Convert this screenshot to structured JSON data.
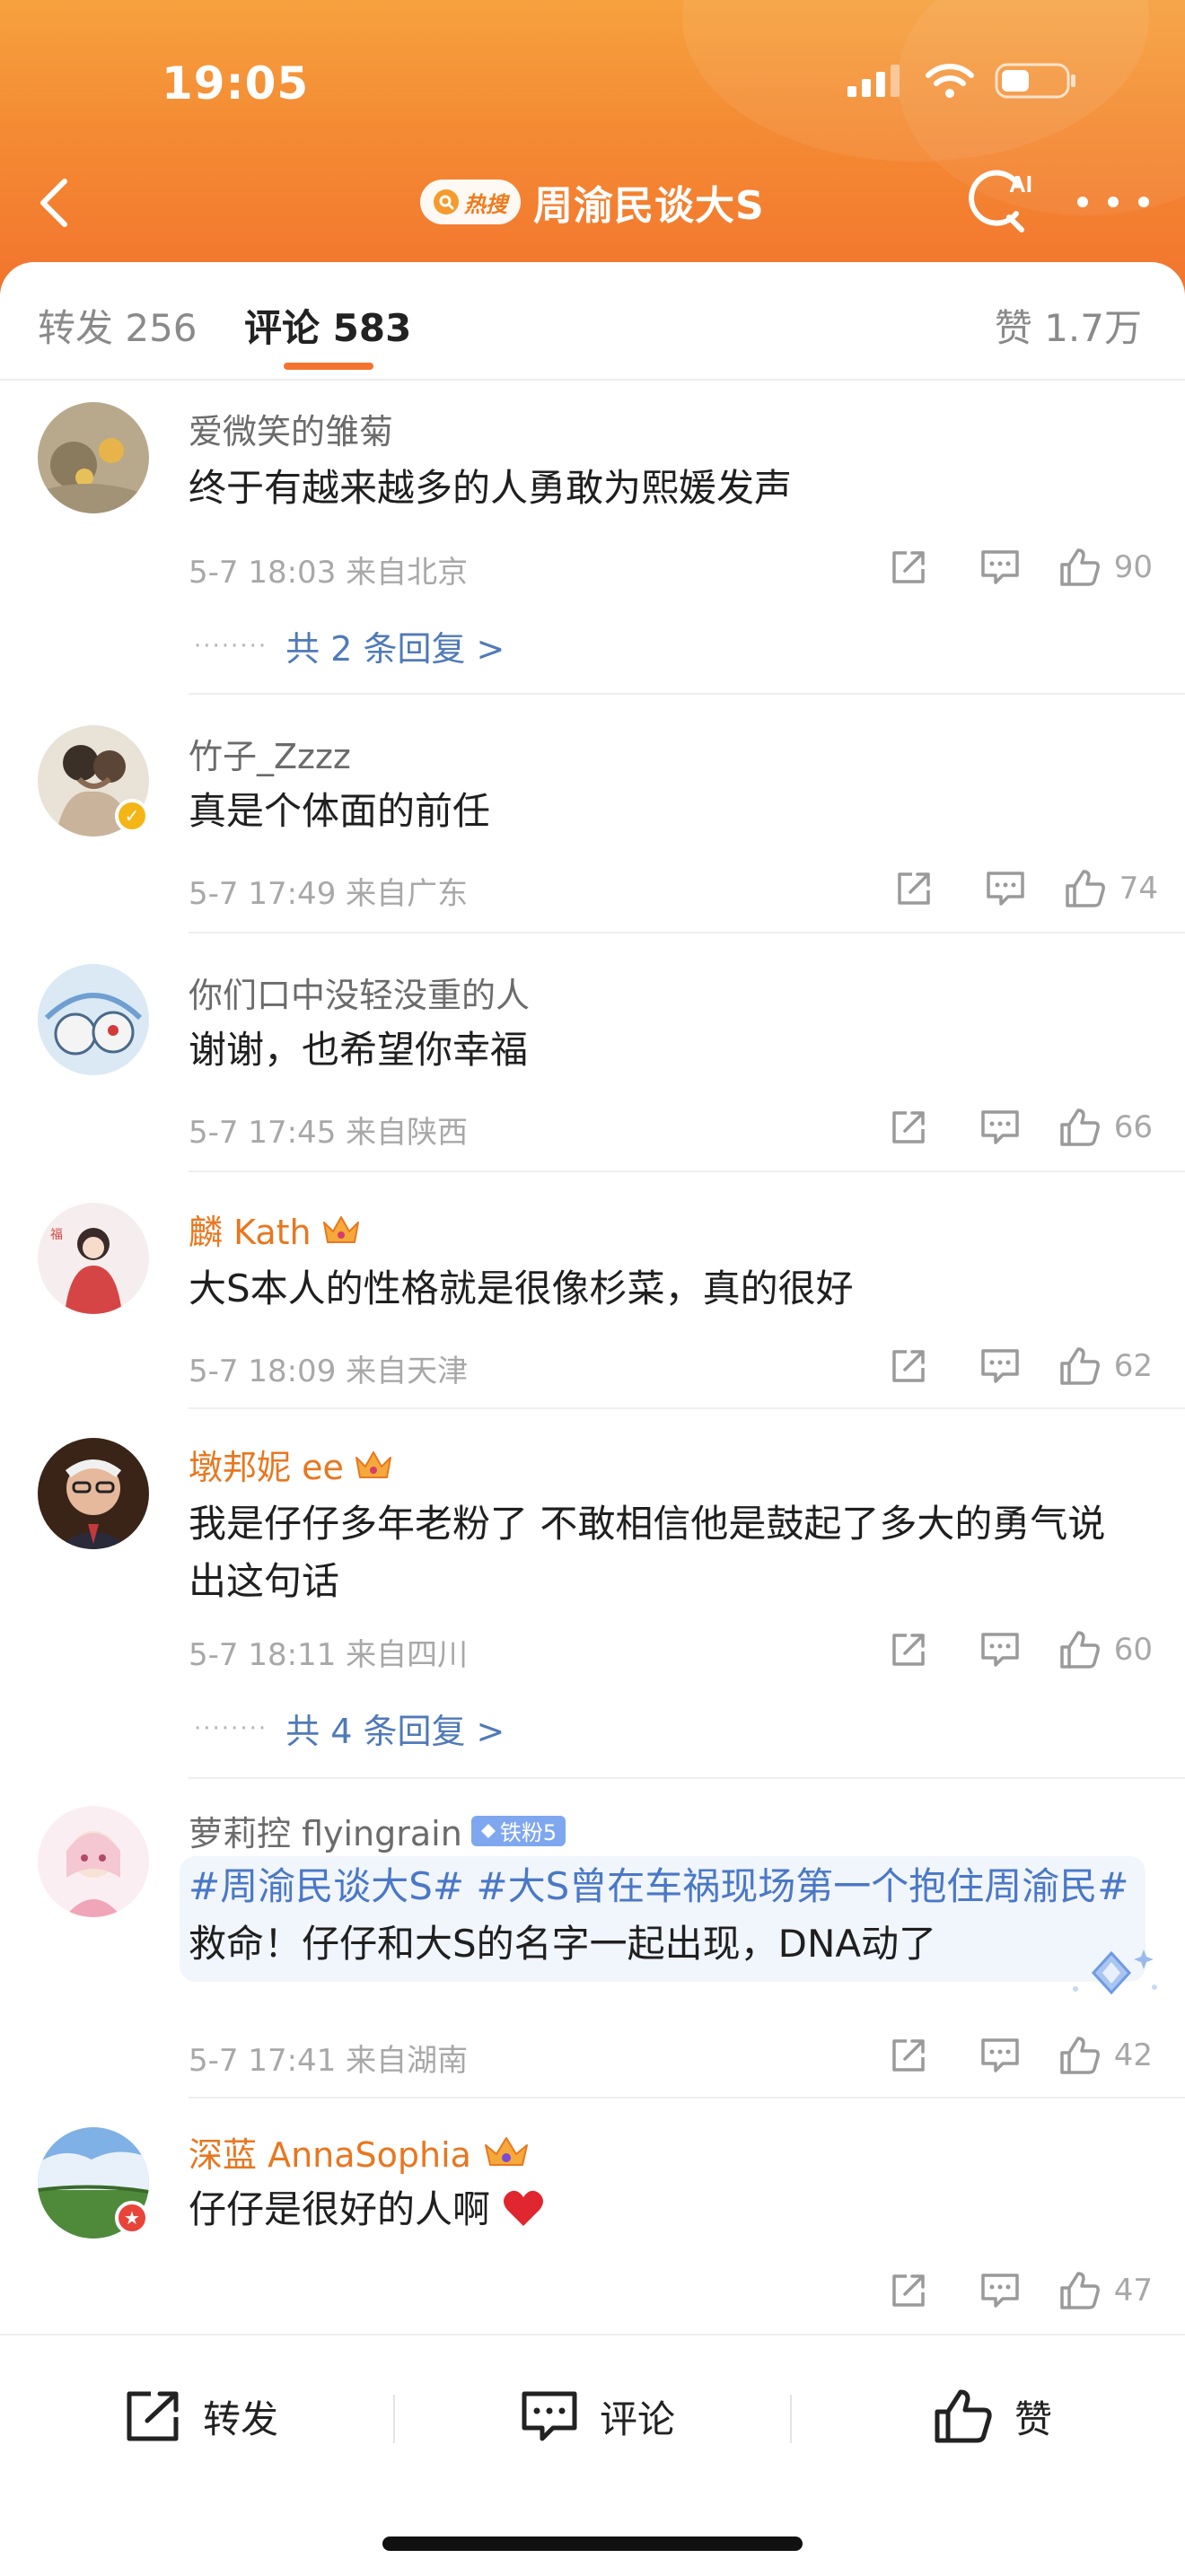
{
  "status_bar": {
    "time": "19:05"
  },
  "nav": {
    "hot_badge": "热搜",
    "title": "周渝民谈大S",
    "ai_label": "AI"
  },
  "tabs": {
    "forward": "转发 256",
    "comment": "评论 583",
    "like": "赞 1.7万"
  },
  "comments": [
    {
      "user": "爱微笑的雏菊",
      "text": "终于有越来越多的人勇敢为熙媛发声",
      "time": "5-7 18:03",
      "location": "来自北京",
      "likes": "90",
      "replies": "共 2 条回复 >"
    },
    {
      "user": "竹子_Zzzz",
      "text": "真是个体面的前任",
      "time": "5-7 17:49",
      "location": "来自广东",
      "likes": "74"
    },
    {
      "user": "你们口中没轻没重的人",
      "text": "谢谢，也希望你幸福",
      "time": "5-7 17:45",
      "location": "来自陕西",
      "likes": "66"
    },
    {
      "user": "麟 Kath",
      "text": "大S本人的性格就是很像杉菜，真的很好",
      "time": "5-7 18:09",
      "location": "来自天津",
      "likes": "62"
    },
    {
      "user": "墩邦妮 ee",
      "text": "我是仔仔多年老粉了 不敢相信他是鼓起了多大的勇气说出这句话",
      "time": "5-7 18:11",
      "location": "来自四川",
      "likes": "60",
      "replies": "共 4 条回复 >"
    },
    {
      "user": "萝莉控 flyingrain",
      "fan_badge": "铁粉5",
      "topic1": "#周渝民谈大S#",
      "topic2": "#大S曾在车祸现场第一个抱住周渝民#",
      "text": " 救命！仔仔和大S的名字一起出现，DNA动了",
      "time": "5-7 17:41",
      "location": "来自湖南",
      "likes": "42"
    },
    {
      "user": "深蓝 AnnaSophia",
      "text": "仔仔是很好的人啊",
      "time": "",
      "location": "",
      "likes": "47"
    }
  ],
  "bottom_bar": {
    "forward": "转发",
    "comment": "评论",
    "like": "赞"
  },
  "colors": {
    "accent": "#f2742e",
    "link": "#4f7ab8",
    "vip": "#e8771f"
  }
}
